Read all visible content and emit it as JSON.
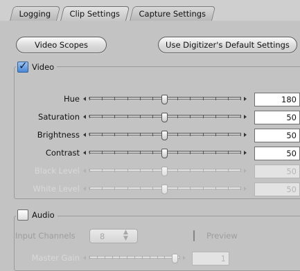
{
  "tabs": [
    {
      "label": "Logging",
      "active": false
    },
    {
      "label": "Clip Settings",
      "active": true
    },
    {
      "label": "Capture Settings",
      "active": false
    }
  ],
  "buttons": {
    "video_scopes": "Video Scopes",
    "use_defaults": "Use Digitizer's Default Settings"
  },
  "video": {
    "label": "Video",
    "checked": true,
    "controls": [
      {
        "label": "Hue",
        "value": "180",
        "level": 0.5,
        "enabled": true
      },
      {
        "label": "Saturation",
        "value": "50",
        "level": 0.5,
        "enabled": true
      },
      {
        "label": "Brightness",
        "value": "50",
        "level": 0.5,
        "enabled": true
      },
      {
        "label": "Contrast",
        "value": "50",
        "level": 0.5,
        "enabled": true
      },
      {
        "label": "Black Level",
        "value": "50",
        "level": 0.5,
        "enabled": false
      },
      {
        "label": "White Level",
        "value": "50",
        "level": 0.5,
        "enabled": false
      }
    ]
  },
  "audio": {
    "label": "Audio",
    "checked": false,
    "input_channels_label": "Input Channels",
    "input_channels_value": "8",
    "preview_label": "Preview",
    "master_gain_label": "Master Gain",
    "master_gain_value": "1",
    "master_gain_level": 0.95
  },
  "colors": {
    "background": "#c3c3c3",
    "checkbox_checked": "#4a88d6"
  }
}
